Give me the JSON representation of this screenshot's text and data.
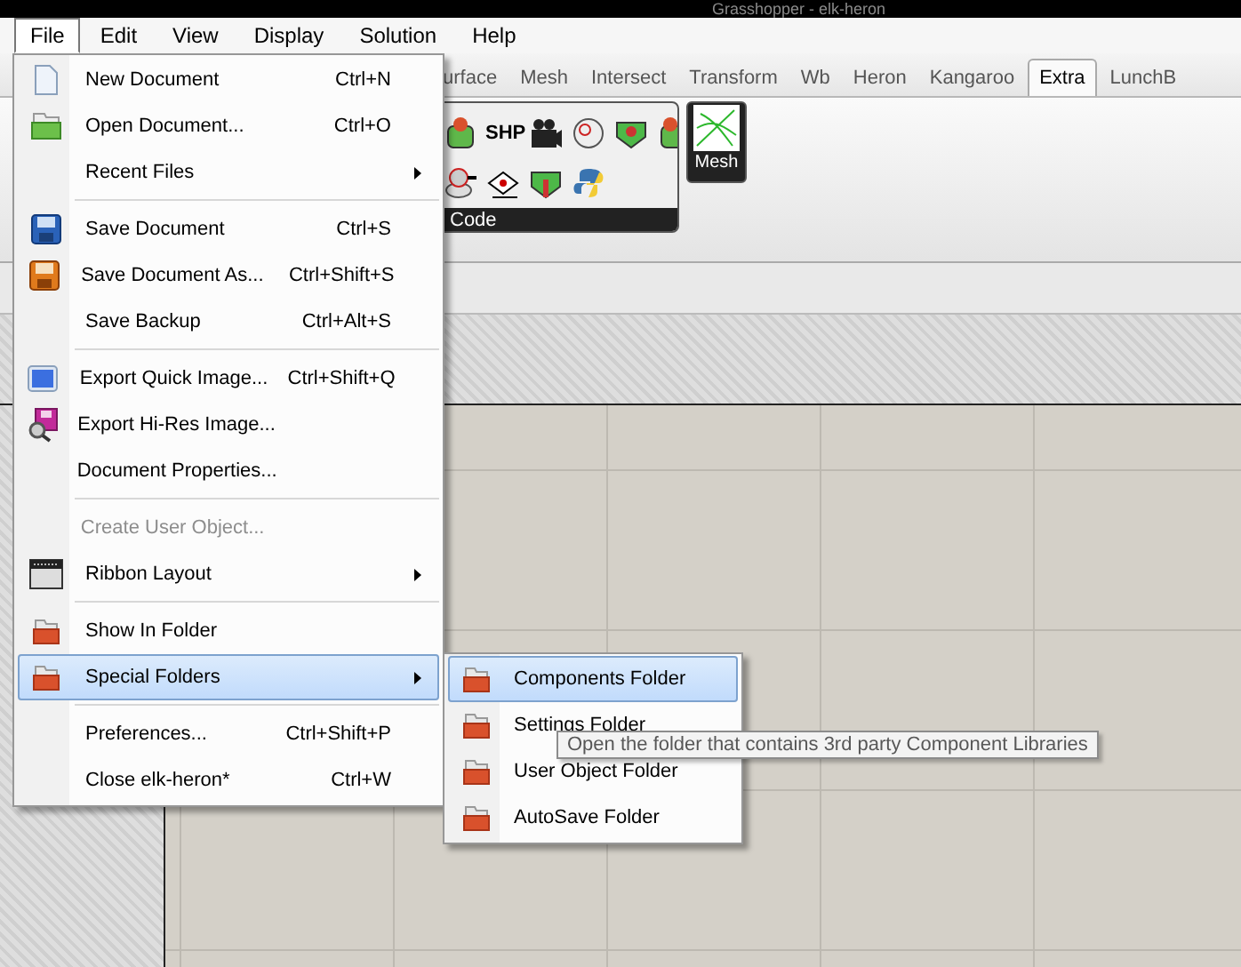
{
  "window": {
    "title": "Grasshopper - elk-heron"
  },
  "menubar": [
    {
      "label": "File",
      "selected": true
    },
    {
      "label": "Edit",
      "selected": false
    },
    {
      "label": "View",
      "selected": false
    },
    {
      "label": "Display",
      "selected": false
    },
    {
      "label": "Solution",
      "selected": false
    },
    {
      "label": "Help",
      "selected": false
    }
  ],
  "ribbon": {
    "tabs": [
      {
        "label": "urface",
        "selected": false
      },
      {
        "label": "Mesh",
        "selected": false
      },
      {
        "label": "Intersect",
        "selected": false
      },
      {
        "label": "Transform",
        "selected": false
      },
      {
        "label": "Wb",
        "selected": false
      },
      {
        "label": "Heron",
        "selected": false
      },
      {
        "label": "Kangaroo",
        "selected": false
      },
      {
        "label": "Extra",
        "selected": true
      },
      {
        "label": "LunchB",
        "selected": false
      }
    ],
    "panels": [
      {
        "label": "Code",
        "icon_text": "SHP"
      },
      {
        "label": "Mesh"
      }
    ]
  },
  "file_menu": [
    {
      "kind": "item",
      "label": "New Document",
      "shortcut": "Ctrl+N",
      "submenu": false,
      "disabled": false,
      "selected": false
    },
    {
      "kind": "item",
      "label": "Open Document...",
      "shortcut": "Ctrl+O",
      "submenu": false,
      "disabled": false,
      "selected": false
    },
    {
      "kind": "item",
      "label": "Recent Files",
      "submenu": true,
      "disabled": false,
      "selected": false
    },
    {
      "kind": "separator"
    },
    {
      "kind": "item",
      "label": "Save Document",
      "shortcut": "Ctrl+S",
      "submenu": false,
      "disabled": false,
      "selected": false
    },
    {
      "kind": "item",
      "label": "Save Document As...",
      "shortcut": "Ctrl+Shift+S",
      "submenu": false,
      "disabled": false,
      "selected": false
    },
    {
      "kind": "item",
      "label": "Save Backup",
      "shortcut": "Ctrl+Alt+S",
      "submenu": false,
      "disabled": false,
      "selected": false
    },
    {
      "kind": "separator"
    },
    {
      "kind": "item",
      "label": "Export Quick Image...",
      "shortcut": "Ctrl+Shift+Q",
      "submenu": false,
      "disabled": false,
      "selected": false
    },
    {
      "kind": "item",
      "label": "Export Hi-Res Image...",
      "submenu": false,
      "disabled": false,
      "selected": false
    },
    {
      "kind": "item",
      "label": "Document Properties...",
      "submenu": false,
      "disabled": false,
      "selected": false
    },
    {
      "kind": "separator"
    },
    {
      "kind": "item",
      "label": "Create User Object...",
      "submenu": false,
      "disabled": true,
      "selected": false
    },
    {
      "kind": "item",
      "label": "Ribbon Layout",
      "submenu": true,
      "disabled": false,
      "selected": false
    },
    {
      "kind": "separator"
    },
    {
      "kind": "item",
      "label": "Show In Folder",
      "submenu": false,
      "disabled": false,
      "selected": false
    },
    {
      "kind": "item",
      "label": "Special Folders",
      "submenu": true,
      "disabled": false,
      "selected": true
    },
    {
      "kind": "separator"
    },
    {
      "kind": "item",
      "label": "Preferences...",
      "shortcut": "Ctrl+Shift+P",
      "submenu": false,
      "disabled": false,
      "selected": false
    },
    {
      "kind": "item",
      "label": "Close elk-heron*",
      "shortcut": "Ctrl+W",
      "submenu": false,
      "disabled": false,
      "selected": false
    }
  ],
  "special_folders_menu": [
    {
      "label": "Components Folder",
      "selected": true
    },
    {
      "label": "Settings Folder",
      "selected": false
    },
    {
      "label": "User Object Folder",
      "selected": false
    },
    {
      "label": "AutoSave Folder",
      "selected": false
    }
  ],
  "tooltip": {
    "text": "Open the folder that contains 3rd party Component Libraries"
  }
}
